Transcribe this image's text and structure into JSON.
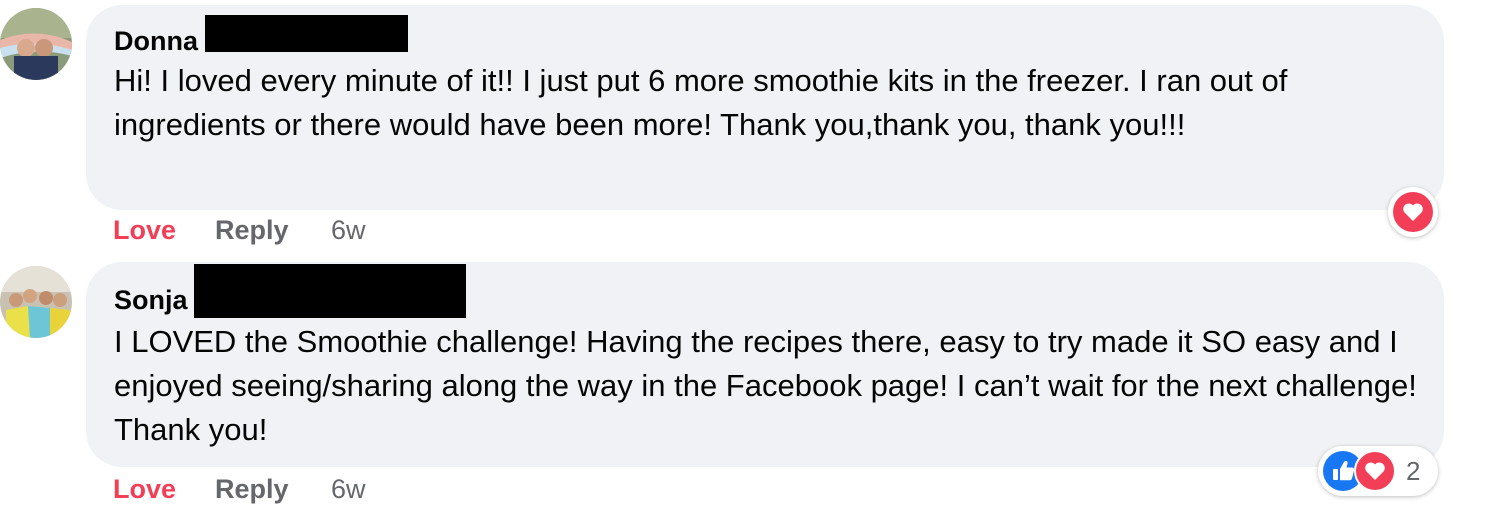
{
  "comments": [
    {
      "author": "Donna",
      "text": "Hi! I loved every minute of it!! I just put 6 more smoothie kits in the freezer. I ran out of ingredients or there would have been more! Thank you,thank you, thank you!!!",
      "actions": {
        "react": "Love",
        "reply": "Reply",
        "time": "6w"
      },
      "reactions": {
        "icons": [
          "heart-reaction-icon"
        ],
        "count": ""
      }
    },
    {
      "author": "Sonja",
      "text": "I LOVED the Smoothie challenge! Having the recipes there, easy to try made it SO easy and I enjoyed seeing/sharing along the way in the Facebook page! I can’t wait for the next challenge! Thank you!",
      "actions": {
        "react": "Love",
        "reply": "Reply",
        "time": "6w"
      },
      "reactions": {
        "icons": [
          "like-reaction-icon",
          "heart-reaction-icon"
        ],
        "count": "2"
      }
    }
  ],
  "colors": {
    "love": "#f33e58",
    "like": "#1877f2",
    "bubble": "#f0f2f5",
    "muted": "#65676b"
  }
}
